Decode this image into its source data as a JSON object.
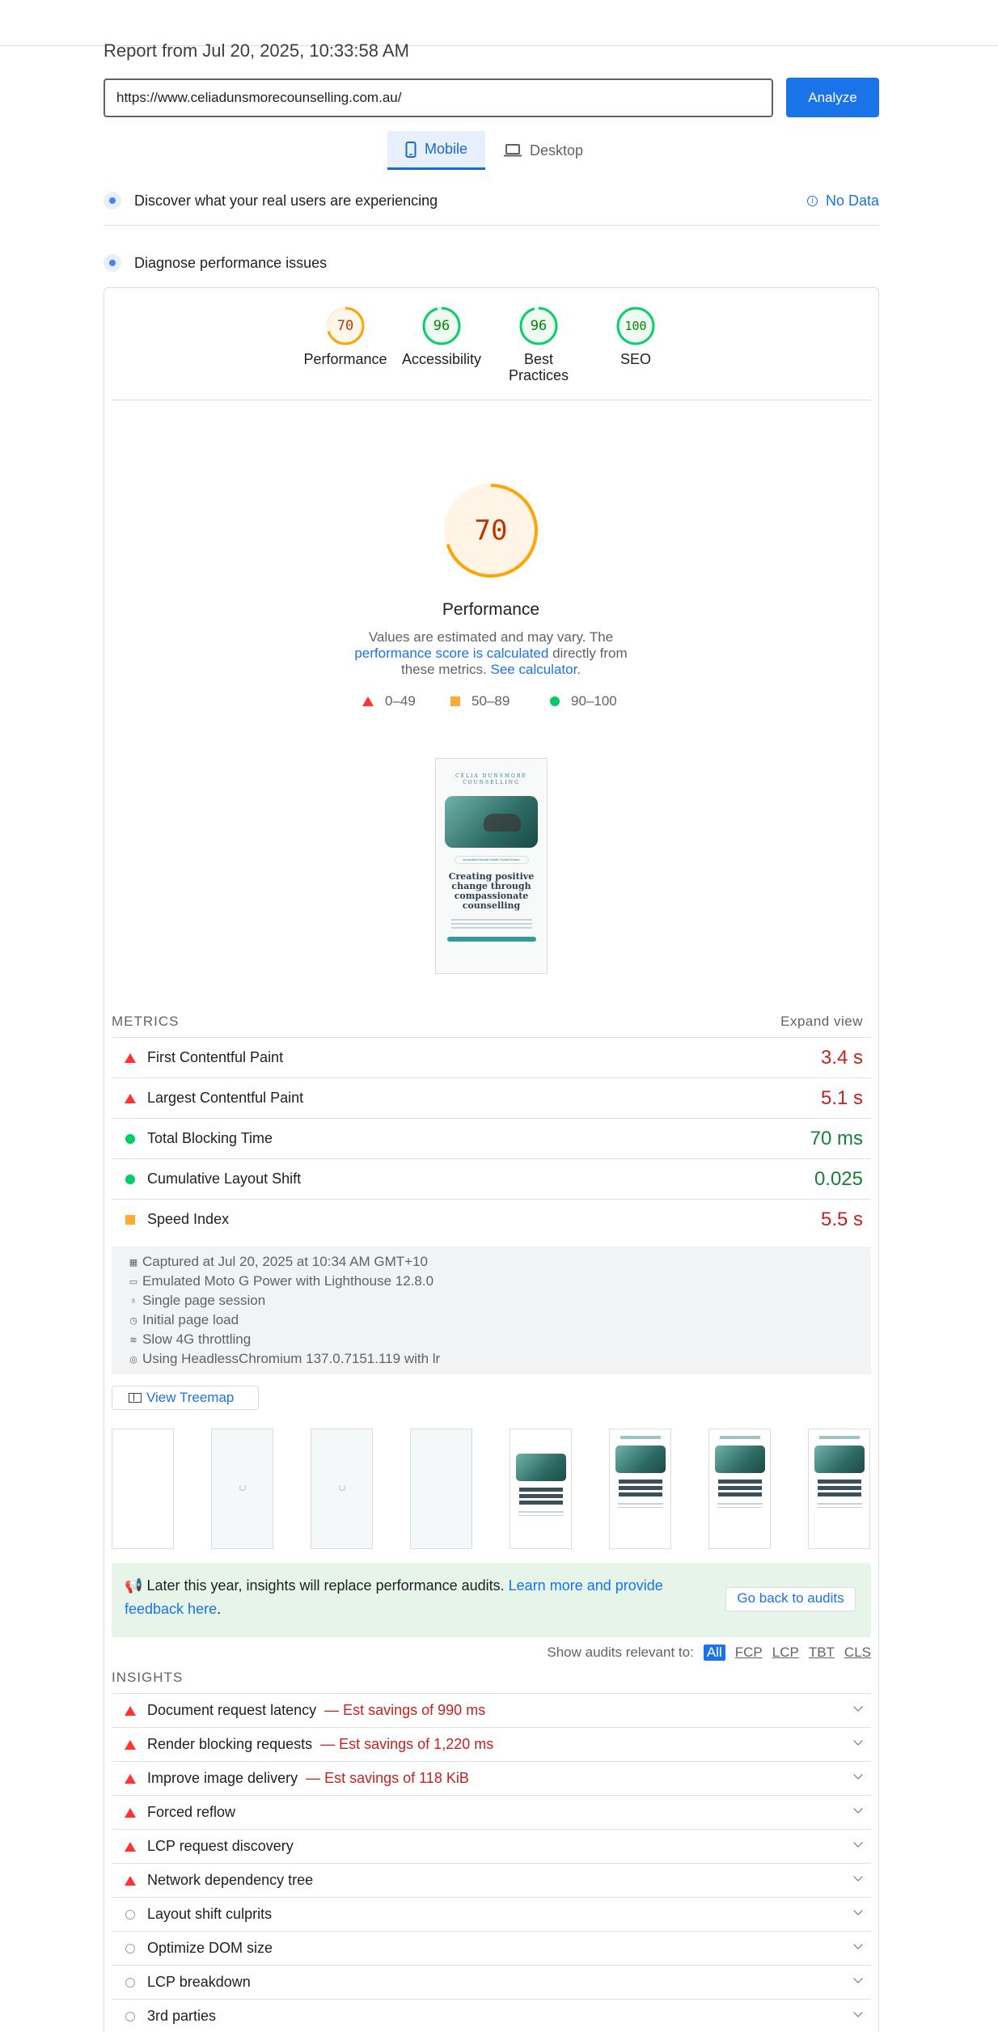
{
  "header": {
    "report_title": "Report from Jul 20, 2025, 10:33:58 AM"
  },
  "search": {
    "url": "https://www.celiadunsmorecounselling.com.au/",
    "analyze_label": "Analyze"
  },
  "tabs": [
    {
      "label": "Mobile",
      "icon": "phone-icon"
    },
    {
      "label": "Desktop",
      "icon": "laptop-icon"
    }
  ],
  "field_data": {
    "label": "Discover what your real users are experiencing",
    "status": "No Data"
  },
  "diagnose": {
    "label": "Diagnose performance issues"
  },
  "categories": [
    {
      "name": "Performance",
      "score": "70",
      "color": "#ffa400"
    },
    {
      "name": "Accessibility",
      "score": "96",
      "color": "#0cce6b"
    },
    {
      "name": "Best Practices",
      "score": "96",
      "color": "#0cce6b"
    },
    {
      "name": "SEO",
      "score": "100",
      "color": "#0cce6b"
    }
  ],
  "performance": {
    "score": "70",
    "title": "Performance",
    "desc_1": "Values are estimated and may vary. The",
    "desc_link": "performance score is calculated",
    "desc_2": " directly from these metrics. ",
    "calc_link": "See calculator.",
    "legend": [
      "0–49",
      "50–89",
      "90–100"
    ]
  },
  "screenshot": {
    "brand": "CELIA DUNSMORE COUNSELLING",
    "pill": "Accredited Mental Health Social Worker",
    "hero_title": "Creating positive change through compassionate counselling"
  },
  "metrics": {
    "heading": "METRICS",
    "expand": "Expand view",
    "items": [
      {
        "name": "First Contentful Paint",
        "value": "3.4 s",
        "status": "fail"
      },
      {
        "name": "Largest Contentful Paint",
        "value": "5.1 s",
        "status": "fail"
      },
      {
        "name": "Total Blocking Time",
        "value": "70 ms",
        "status": "pass"
      },
      {
        "name": "Cumulative Layout Shift",
        "value": "0.025",
        "status": "pass"
      },
      {
        "name": "Speed Index",
        "value": "5.5 s",
        "status": "average"
      }
    ]
  },
  "environment": [
    "Captured at Jul 20, 2025 at 10:34 AM GMT+10",
    "Emulated Moto G Power with Lighthouse 12.8.0",
    "Single page session",
    "Initial page load",
    "Slow 4G throttling",
    "Using HeadlessChromium 137.0.7151.119 with lr"
  ],
  "treemap": {
    "label": "View Treemap"
  },
  "notice": {
    "text": "Later this year, insights will replace performance audits. ",
    "link": "Learn more and provide feedback here",
    "end": ".",
    "back": "Go back to audits"
  },
  "filters": {
    "label": "Show audits relevant to:",
    "options": [
      "All",
      "FCP",
      "LCP",
      "TBT",
      "CLS"
    ]
  },
  "insights": {
    "heading": "INSIGHTS",
    "items": [
      {
        "name": "Document request latency",
        "savings": "— Est savings of 990 ms",
        "status": "fail"
      },
      {
        "name": "Render blocking requests",
        "savings": "— Est savings of 1,220 ms",
        "status": "fail"
      },
      {
        "name": "Improve image delivery",
        "savings": "— Est savings of 118 KiB",
        "status": "fail"
      },
      {
        "name": "Forced reflow",
        "savings": "",
        "status": "fail"
      },
      {
        "name": "LCP request discovery",
        "savings": "",
        "status": "fail"
      },
      {
        "name": "Network dependency tree",
        "savings": "",
        "status": "fail"
      },
      {
        "name": "Layout shift culprits",
        "savings": "",
        "status": "info"
      },
      {
        "name": "Optimize DOM size",
        "savings": "",
        "status": "info"
      },
      {
        "name": "LCP breakdown",
        "savings": "",
        "status": "info"
      },
      {
        "name": "3rd parties",
        "savings": "",
        "status": "info"
      }
    ]
  }
}
